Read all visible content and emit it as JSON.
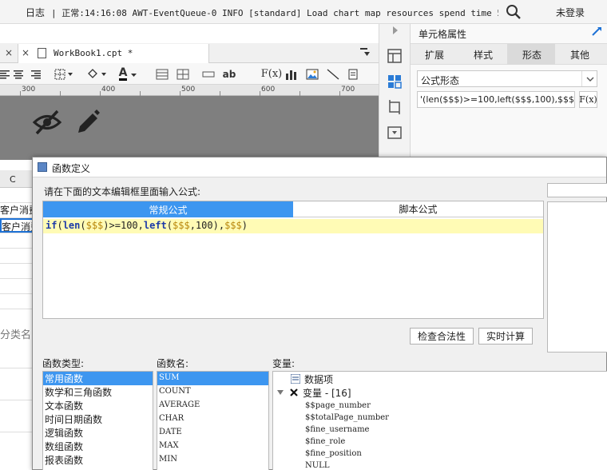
{
  "topbar": {
    "log_label": "日志",
    "log_text": "| 正常:14:16:08 AWT-EventQueue-0 INFO [standard] Load chart map resources spend time 5438 ms",
    "login": "未登录"
  },
  "workbook": {
    "tab_close_left": "×",
    "tab_close": "×",
    "tab_title": "WorkBook1.cpt *",
    "toolbar": {
      "ab": "ab",
      "fx": "F(x)",
      "font_color": "A"
    },
    "ruler": [
      "300",
      "400",
      "500",
      "600",
      "700"
    ],
    "column_header": "C",
    "cells": [
      "客户消费",
      "客户消费",
      "分类名"
    ]
  },
  "properties": {
    "title": "单元格属性",
    "tabs": [
      "扩展",
      "样式",
      "形态",
      "其他"
    ],
    "active_tab": "形态",
    "shape_select": "公式形态",
    "formula": "'(len($$$)>=100,left($$$,100),$$$)",
    "fx_button": "F(x)"
  },
  "dialog": {
    "title": "函数定义",
    "prompt": "请在下面的文本编辑框里面输入公式:",
    "mode_tabs": {
      "regular": "常规公式",
      "script": "脚本公式"
    },
    "formula_tokens": {
      "if": "if",
      "p1": "(",
      "len": "len",
      "p2": "(",
      "v1": "$$$",
      "p3": ")>=100,",
      "left": "left",
      "p4": "(",
      "v2": "$$$",
      "p5": ",100),",
      "v3": "$$$",
      "p6": ")"
    },
    "buttons": {
      "check": "检查合法性",
      "calc": "实时计算"
    },
    "labels": {
      "types": "函数类型:",
      "funcs": "函数名:",
      "vars": "变量:"
    },
    "function_types": [
      "常用函数",
      "数学和三角函数",
      "文本函数",
      "时间日期函数",
      "逻辑函数",
      "数组函数",
      "报表函数"
    ],
    "function_names": [
      "SUM",
      "COUNT",
      "AVERAGE",
      "CHAR",
      "DATE",
      "MAX",
      "MIN"
    ],
    "variables": {
      "root": "数据项",
      "group": "变量 - [16]",
      "items": [
        "$$page_number",
        "$$totalPage_number",
        "$fine_username",
        "$fine_role",
        "$fine_position",
        "NULL"
      ]
    }
  },
  "colors": {
    "accent": "#3d96f0",
    "formula_bg": "#fffbb5",
    "canvas_gray": "#7f7f7f"
  }
}
